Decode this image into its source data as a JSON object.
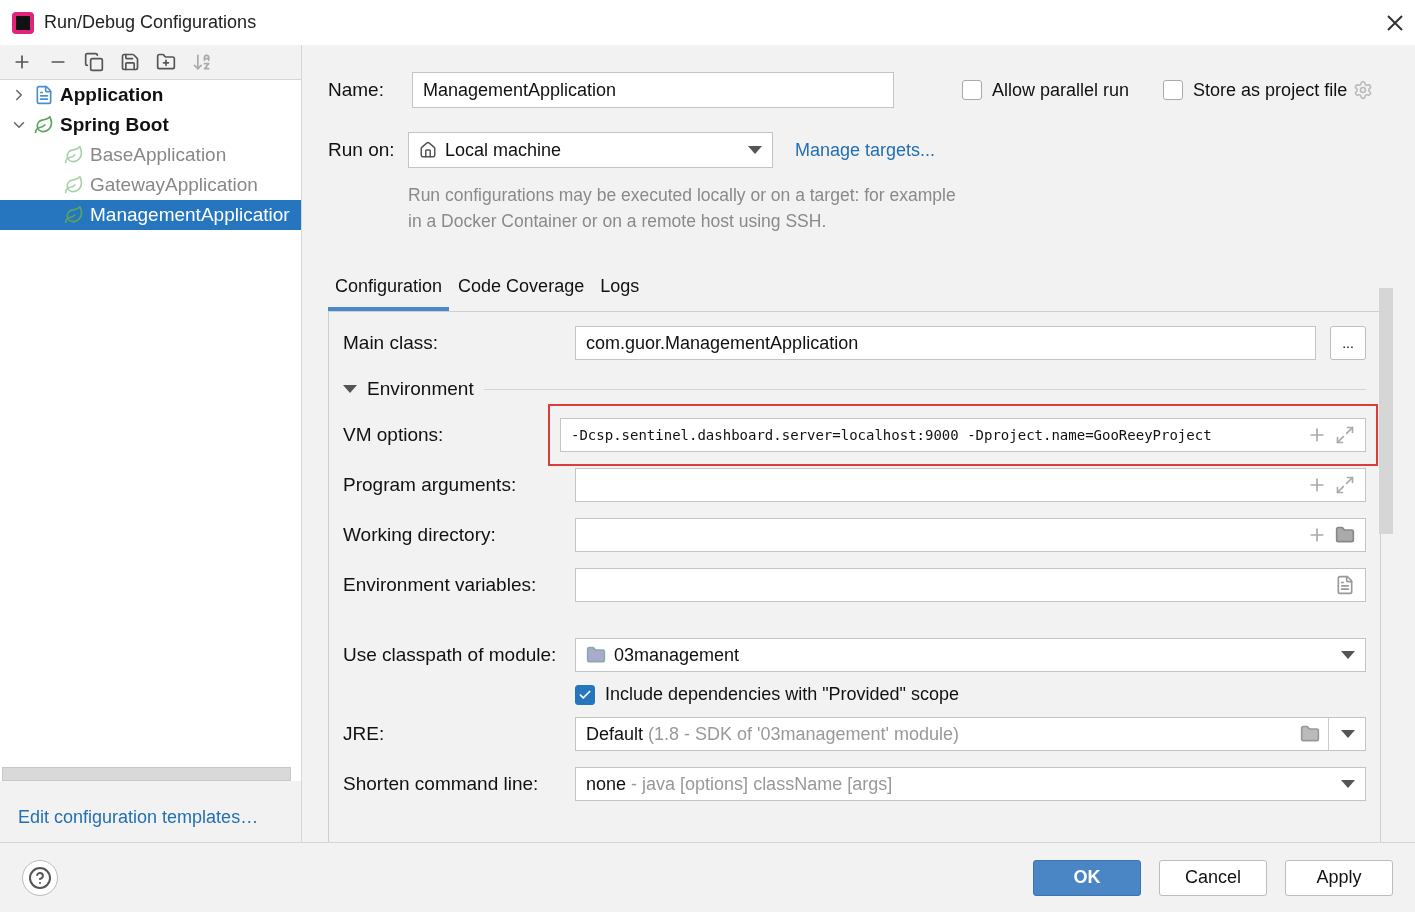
{
  "window": {
    "title": "Run/Debug Configurations"
  },
  "tree": [
    {
      "label": "Application",
      "expanded": false,
      "selected": false,
      "greyed": false
    },
    {
      "label": "Spring Boot",
      "expanded": true,
      "selected": false,
      "greyed": false,
      "children": [
        {
          "label": "BaseApplication",
          "selected": false,
          "greyed": true
        },
        {
          "label": "GatewayApplication",
          "selected": false,
          "greyed": true
        },
        {
          "label": "ManagementApplicatior",
          "selected": true,
          "greyed": false
        }
      ]
    }
  ],
  "templates_link": "Edit configuration templates…",
  "name": {
    "label": "Name:",
    "value": "ManagementApplication"
  },
  "options": [
    {
      "label": "Allow parallel run",
      "checked": false
    },
    {
      "label": "Store as project file",
      "checked": false
    }
  ],
  "run_on": {
    "label": "Run on:",
    "value": "Local machine",
    "link": "Manage targets..."
  },
  "hint": "Run configurations may be executed locally or on a target: for example in a Docker Container or on a remote host using SSH.",
  "tabs": [
    {
      "label": "Configuration",
      "selected": true
    },
    {
      "label": "Code Coverage",
      "selected": false
    },
    {
      "label": "Logs",
      "selected": false
    }
  ],
  "main_class": {
    "label": "Main class:",
    "value": "com.guor.ManagementApplication",
    "button": "..."
  },
  "section": {
    "label": "Environment",
    "expanded": true
  },
  "fields": [
    {
      "kind": "expand",
      "label": "VM options:",
      "value": "-Dcsp.sentinel.dashboard.server=localhost:9000 -Dproject.name=GooReeyProject",
      "highlighted": true
    },
    {
      "kind": "expand",
      "label": "Program arguments:",
      "highlighted": false
    },
    {
      "kind": "folder",
      "label": "Working directory:",
      "highlighted": false
    },
    {
      "kind": "list",
      "label": "Environment variables:",
      "highlighted": false
    }
  ],
  "classpath": {
    "label": "Use classpath of module:",
    "value": "03management"
  },
  "include": {
    "label": "Include dependencies with \"Provided\" scope",
    "checked": true
  },
  "jre": {
    "label": "JRE:",
    "value": "Default",
    "detail": "(1.8 - SDK of '03management' module)"
  },
  "shorten": {
    "label": "Shorten command line:",
    "value": "none",
    "detail": "- java [options] className [args]"
  },
  "buttons": [
    {
      "label": "OK",
      "primary": true
    },
    {
      "label": "Cancel",
      "primary": false
    },
    {
      "label": "Apply",
      "primary": false
    }
  ]
}
